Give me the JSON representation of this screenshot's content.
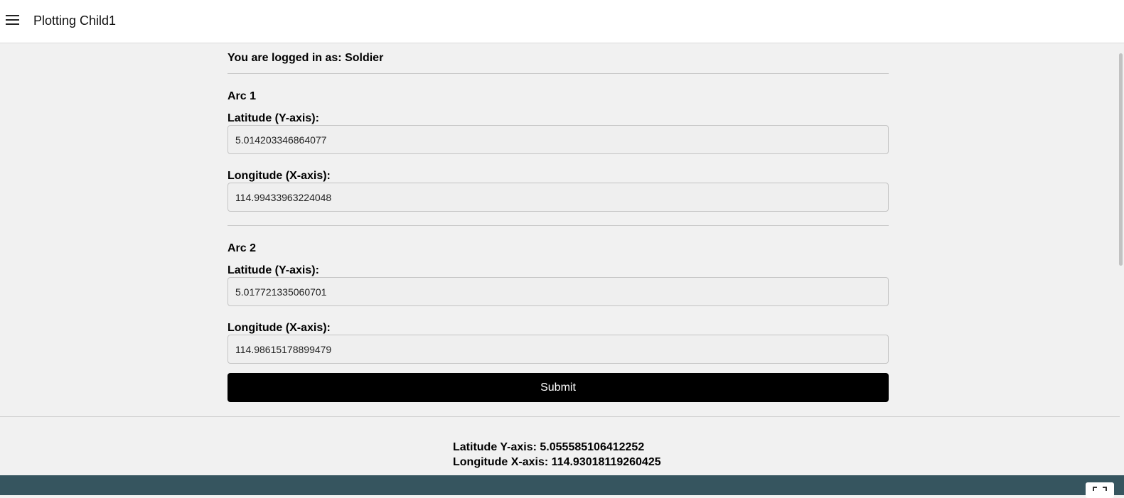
{
  "header": {
    "title": "Plotting Child1",
    "menu_icon": "menu-icon"
  },
  "main": {
    "logged_in_text": "You are logged in as: Soldier",
    "arcs": [
      {
        "title": "Arc 1",
        "latitude_label": "Latitude (Y-axis):",
        "latitude_value": "5.014203346864077",
        "longitude_label": "Longitude (X-axis):",
        "longitude_value": "114.99433963224048"
      },
      {
        "title": "Arc 2",
        "latitude_label": "Latitude (Y-axis):",
        "latitude_value": "5.017721335060701",
        "longitude_label": "Longitude (X-axis):",
        "longitude_value": "114.98615178899479"
      }
    ],
    "submit_label": "Submit"
  },
  "result": {
    "latitude_text": "Latitude Y-axis: 5.055585106412252",
    "longitude_text": "Longitude X-axis: 114.93018119260425"
  },
  "colors": {
    "footer": "#36555f",
    "submit_bg": "#000000",
    "page_bg": "#f1f1f1"
  }
}
